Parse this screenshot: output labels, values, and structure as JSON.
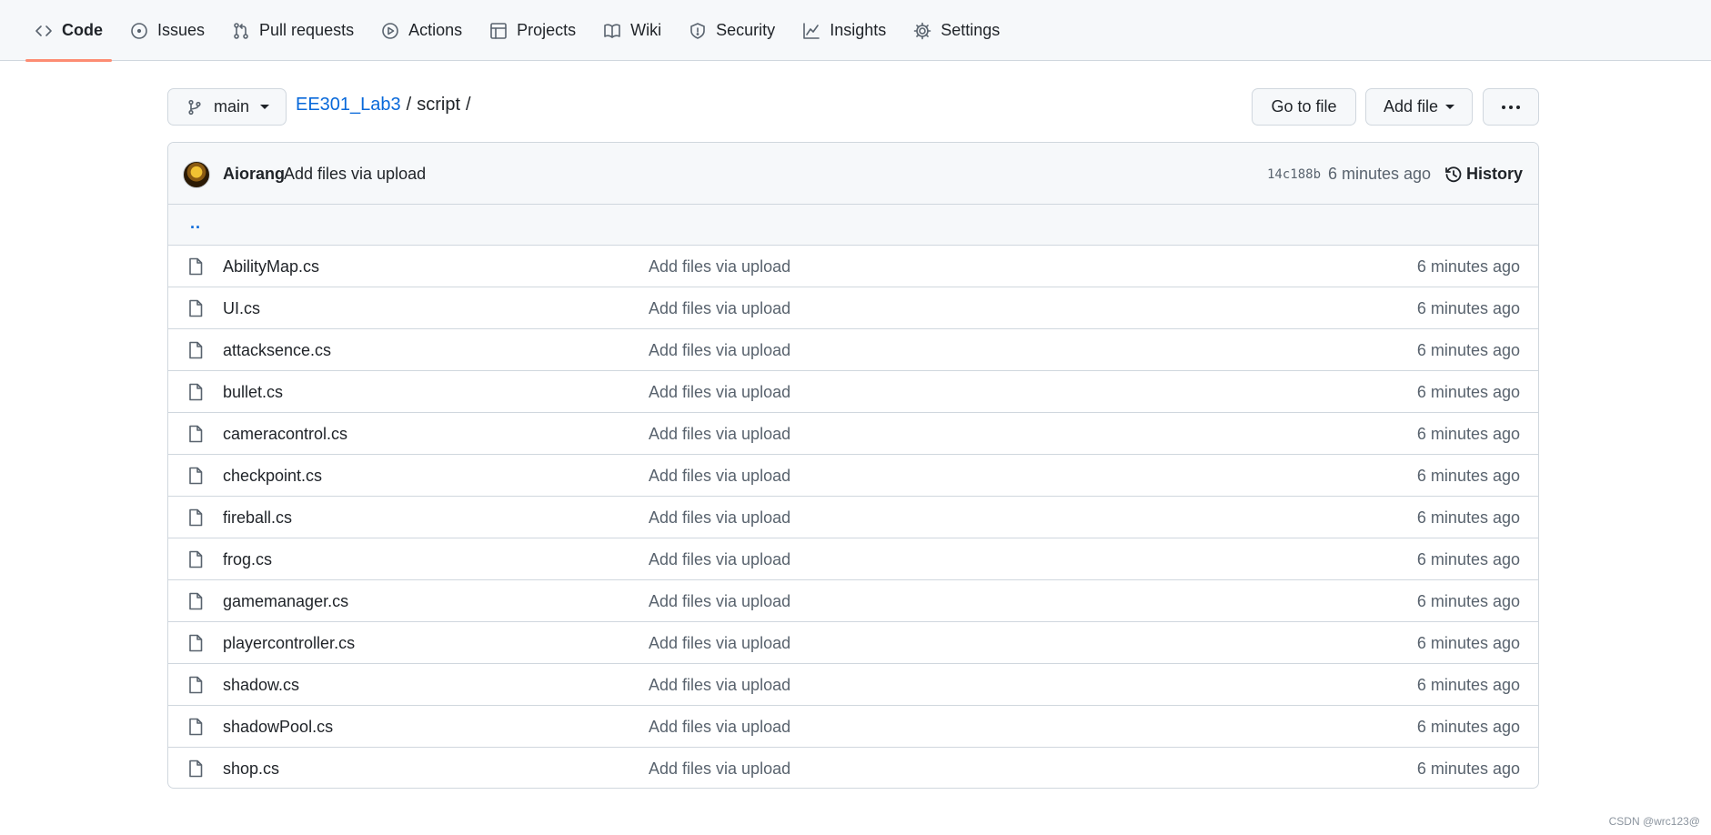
{
  "nav": {
    "items": [
      {
        "label": "Code",
        "icon": "code-icon"
      },
      {
        "label": "Issues",
        "icon": "issue-icon"
      },
      {
        "label": "Pull requests",
        "icon": "pull-request-icon"
      },
      {
        "label": "Actions",
        "icon": "play-icon"
      },
      {
        "label": "Projects",
        "icon": "table-icon"
      },
      {
        "label": "Wiki",
        "icon": "book-icon"
      },
      {
        "label": "Security",
        "icon": "shield-icon"
      },
      {
        "label": "Insights",
        "icon": "graph-icon"
      },
      {
        "label": "Settings",
        "icon": "gear-icon"
      }
    ],
    "selected": "Code"
  },
  "branch": {
    "name": "main"
  },
  "breadcrumb": {
    "repo": "EE301_Lab3",
    "sep": "/",
    "folder": "script",
    "trail": "/"
  },
  "buttons": {
    "go_to_file": "Go to file",
    "add_file": "Add file"
  },
  "commit": {
    "author": "Aiorang",
    "message": "Add files via upload",
    "sha": "14c188b",
    "time": "6 minutes ago",
    "history_label": "History"
  },
  "parent_dir": "..",
  "files": [
    {
      "name": "AbilityMap.cs",
      "message": "Add files via upload",
      "time": "6 minutes ago"
    },
    {
      "name": "UI.cs",
      "message": "Add files via upload",
      "time": "6 minutes ago"
    },
    {
      "name": "attacksence.cs",
      "message": "Add files via upload",
      "time": "6 minutes ago"
    },
    {
      "name": "bullet.cs",
      "message": "Add files via upload",
      "time": "6 minutes ago"
    },
    {
      "name": "cameracontrol.cs",
      "message": "Add files via upload",
      "time": "6 minutes ago"
    },
    {
      "name": "checkpoint.cs",
      "message": "Add files via upload",
      "time": "6 minutes ago"
    },
    {
      "name": "fireball.cs",
      "message": "Add files via upload",
      "time": "6 minutes ago"
    },
    {
      "name": "frog.cs",
      "message": "Add files via upload",
      "time": "6 minutes ago"
    },
    {
      "name": "gamemanager.cs",
      "message": "Add files via upload",
      "time": "6 minutes ago"
    },
    {
      "name": "playercontroller.cs",
      "message": "Add files via upload",
      "time": "6 minutes ago"
    },
    {
      "name": "shadow.cs",
      "message": "Add files via upload",
      "time": "6 minutes ago"
    },
    {
      "name": "shadowPool.cs",
      "message": "Add files via upload",
      "time": "6 minutes ago"
    },
    {
      "name": "shop.cs",
      "message": "Add files via upload",
      "time": "6 minutes ago"
    }
  ],
  "watermark": "CSDN @wrc123@",
  "colors": {
    "accent_underline": "#fd8c73",
    "link": "#0969da",
    "muted": "#59636e"
  }
}
